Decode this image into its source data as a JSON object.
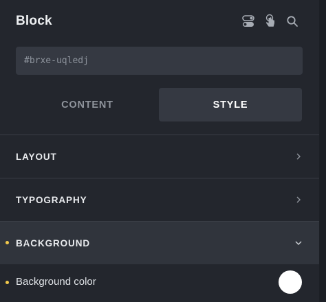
{
  "header": {
    "title": "Block",
    "icons": [
      "toggle-icon",
      "pointer-hand-icon",
      "search-icon"
    ]
  },
  "id_field": {
    "placeholder": "#brxe-uqledj"
  },
  "tabs": [
    {
      "label": "CONTENT",
      "active": false
    },
    {
      "label": "STYLE",
      "active": true
    }
  ],
  "sections": [
    {
      "label": "LAYOUT",
      "expanded": false
    },
    {
      "label": "TYPOGRAPHY",
      "expanded": false
    },
    {
      "label": "BACKGROUND",
      "expanded": true
    }
  ],
  "background": {
    "color_label": "Background color",
    "color_value": "#ffffff"
  },
  "colors": {
    "indicator": "#f2c94c",
    "panel": "#23262d",
    "field": "#353942"
  }
}
